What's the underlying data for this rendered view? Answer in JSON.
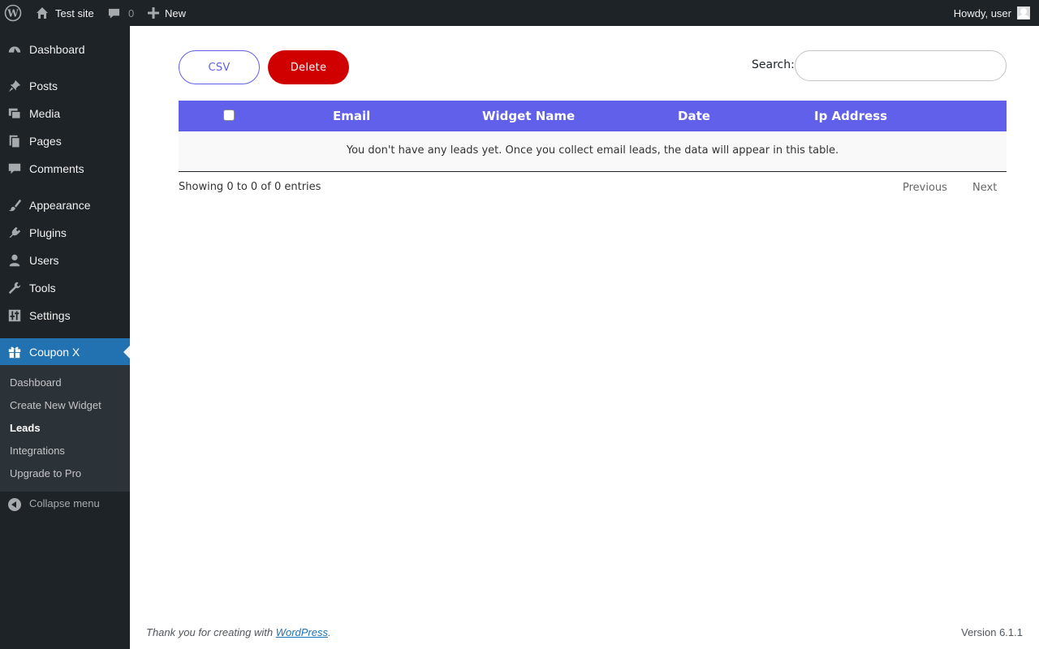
{
  "admin_bar": {
    "site_name": "Test site",
    "comments_count": "0",
    "new_label": "New",
    "howdy": "Howdy, user"
  },
  "sidebar": {
    "items": [
      {
        "label": "Dashboard",
        "icon": "dashboard-icon"
      },
      {
        "label": "Posts",
        "icon": "pushpin-icon"
      },
      {
        "label": "Media",
        "icon": "media-icon"
      },
      {
        "label": "Pages",
        "icon": "pages-icon"
      },
      {
        "label": "Comments",
        "icon": "comment-icon"
      },
      {
        "label": "Appearance",
        "icon": "paintbrush-icon"
      },
      {
        "label": "Plugins",
        "icon": "plug-icon"
      },
      {
        "label": "Users",
        "icon": "user-icon"
      },
      {
        "label": "Tools",
        "icon": "wrench-icon"
      },
      {
        "label": "Settings",
        "icon": "sliders-icon"
      },
      {
        "label": "Coupon X",
        "icon": "gift-icon",
        "active": true
      }
    ],
    "submenu": [
      {
        "label": "Dashboard"
      },
      {
        "label": "Create New Widget"
      },
      {
        "label": "Leads",
        "current": true
      },
      {
        "label": "Integrations"
      },
      {
        "label": "Upgrade to Pro"
      }
    ],
    "collapse_label": "Collapse menu"
  },
  "toolbar": {
    "csv_label": "CSV",
    "delete_label": "Delete",
    "search_label": "Search:",
    "search_value": ""
  },
  "table": {
    "columns": [
      "Email",
      "Widget Name",
      "Date",
      "Ip Address"
    ],
    "empty_message": "You don't have any leads yet. Once you collect email leads, the data will appear in this table.",
    "info": "Showing 0 to 0 of 0 entries",
    "prev_label": "Previous",
    "next_label": "Next"
  },
  "footer": {
    "thanks_prefix": "Thank you for creating with ",
    "wordpress_link": "WordPress",
    "thanks_suffix": ".",
    "version": "Version 6.1.1"
  },
  "colors": {
    "admin_bg": "#1d2327",
    "active_menu": "#2271b1",
    "table_header": "#6060ea",
    "delete_button": "#d10000",
    "csv_button_border": "#5f5fe9"
  }
}
